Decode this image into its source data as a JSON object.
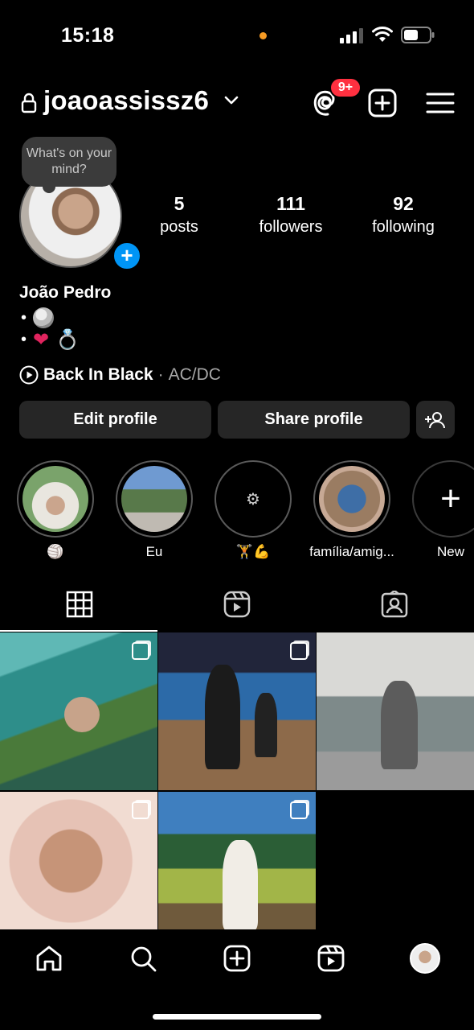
{
  "status_bar": {
    "time": "15:18",
    "icons": [
      "signal-icon",
      "wifi-icon",
      "battery-icon"
    ]
  },
  "header": {
    "username": "joaoassissz6",
    "threads_badge": "9+",
    "icons": [
      "lock-icon",
      "chevron-down-icon",
      "threads-icon",
      "new-post-icon",
      "menu-icon"
    ]
  },
  "profile": {
    "note": "What's on your mind?",
    "stats": {
      "posts_count": "5",
      "posts_label": "posts",
      "followers_count": "111",
      "followers_label": "followers",
      "following_count": "92",
      "following_label": "following"
    },
    "name": "João Pedro",
    "bio_bullet": "•",
    "bio_emojis": [
      "volleyball",
      "heart",
      "ring"
    ],
    "music": {
      "song": "Back In Black",
      "separator": "·",
      "artist": "AC/DC"
    }
  },
  "actions": {
    "edit": "Edit profile",
    "share": "Share profile"
  },
  "highlights": [
    {
      "label": "🏐",
      "icon": "volleyball"
    },
    {
      "label": "Eu"
    },
    {
      "label": "🏋️💪",
      "inner": "⚙"
    },
    {
      "label": "família/amig..."
    },
    {
      "label": "New",
      "inner": "+"
    }
  ],
  "tabs": [
    "grid-icon",
    "reels-icon",
    "tagged-icon"
  ],
  "posts": [
    {
      "multi": true
    },
    {
      "multi": true
    },
    {
      "multi": false
    },
    {
      "multi": true
    },
    {
      "multi": true
    }
  ],
  "bottom_nav": [
    "home-icon",
    "search-icon",
    "create-icon",
    "reels-icon",
    "profile-avatar"
  ],
  "colors": {
    "background": "#000000",
    "accent_blue": "#0095f6",
    "badge_red": "#ff3040",
    "button_gray": "#262626",
    "secondary_text": "#a8a8a8"
  }
}
